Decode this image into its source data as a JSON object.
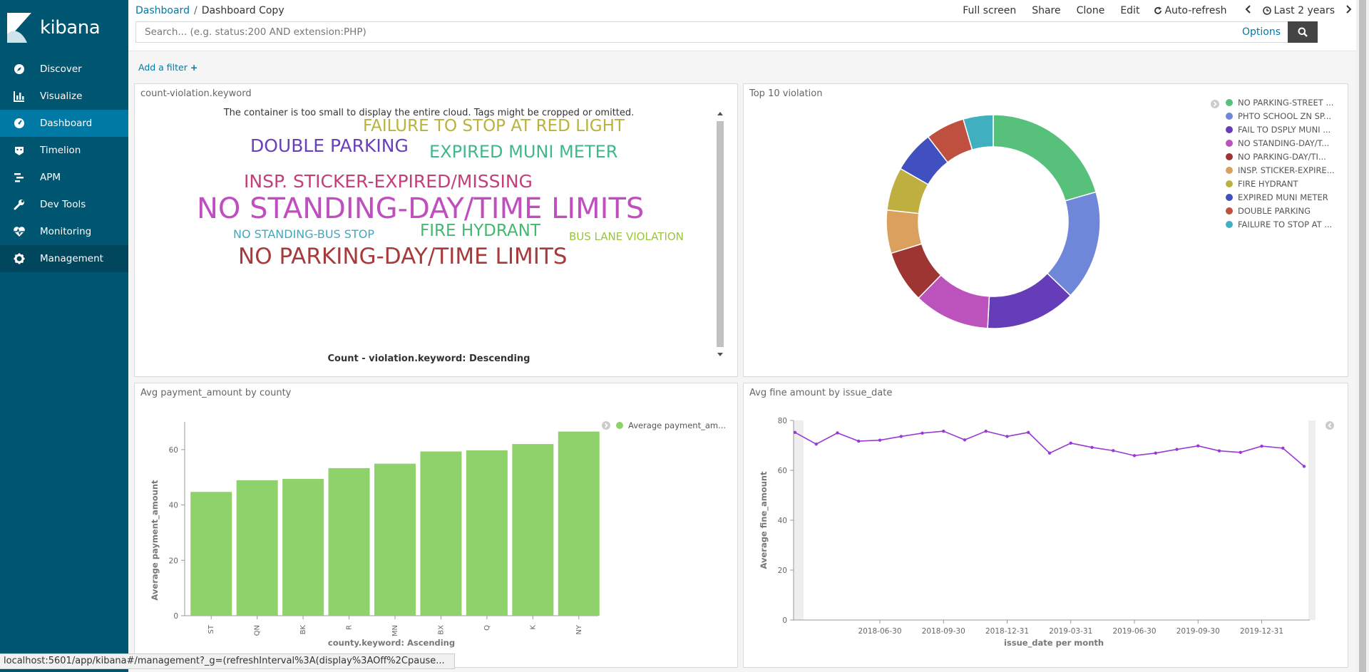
{
  "app": {
    "brand": "kibana"
  },
  "sidebar": {
    "items": [
      {
        "label": "Discover",
        "icon": "compass-icon"
      },
      {
        "label": "Visualize",
        "icon": "bar-chart-icon"
      },
      {
        "label": "Dashboard",
        "icon": "dashboard-icon",
        "active": true
      },
      {
        "label": "Timelion",
        "icon": "timelion-icon"
      },
      {
        "label": "APM",
        "icon": "apm-icon"
      },
      {
        "label": "Dev Tools",
        "icon": "wrench-icon"
      },
      {
        "label": "Monitoring",
        "icon": "heartbeat-icon"
      },
      {
        "label": "Management",
        "icon": "gear-icon"
      }
    ]
  },
  "breadcrumb": {
    "parent": "Dashboard",
    "separator": "/",
    "current": "Dashboard Copy"
  },
  "top_actions": {
    "full_screen": "Full screen",
    "share": "Share",
    "clone": "Clone",
    "edit": "Edit",
    "auto_refresh": "Auto-refresh",
    "time_range": "Last 2 years"
  },
  "search": {
    "placeholder": "Search... (e.g. status:200 AND extension:PHP)",
    "value": "",
    "options_label": "Options"
  },
  "filters": {
    "add_label": "Add a filter"
  },
  "panels": {
    "cloud": {
      "title": "count-violation.keyword",
      "warning": "The container is too small to display the entire cloud. Tags might be cropped or omitted.",
      "footer": "Count - violation.keyword: Descending",
      "words": [
        {
          "text": "FAILURE TO STOP AT RED LIGHT",
          "color": "#b9b33c"
        },
        {
          "text": "DOUBLE PARKING",
          "color": "#6a3fb8"
        },
        {
          "text": "EXPIRED MUNI METER",
          "color": "#3fb88a"
        },
        {
          "text": "INSP. STICKER-EXPIRED/MISSING",
          "color": "#c43e7a"
        },
        {
          "text": "NO STANDING-DAY/TIME LIMITS",
          "color": "#c04ec0"
        },
        {
          "text": "NO STANDING-BUS STOP",
          "color": "#44a7c0"
        },
        {
          "text": "FIRE HYDRANT",
          "color": "#44b870"
        },
        {
          "text": "BUS LANE VIOLATION",
          "color": "#9ac43e"
        },
        {
          "text": "NO PARKING-DAY/TIME LIMITS",
          "color": "#a73a3a"
        }
      ]
    },
    "pie": {
      "title": "Top 10 violation",
      "legend": [
        {
          "label": "NO PARKING-STREET ...",
          "color": "#57c17b"
        },
        {
          "label": "PHTO SCHOOL ZN SP...",
          "color": "#6f87d8"
        },
        {
          "label": "FAIL TO DSPLY MUNI ...",
          "color": "#663db8"
        },
        {
          "label": "NO STANDING-DAY/T...",
          "color": "#bc52bc"
        },
        {
          "label": "NO PARKING-DAY/TI...",
          "color": "#9e3533"
        },
        {
          "label": "INSP. STICKER-EXPIRE...",
          "color": "#daa05d"
        },
        {
          "label": "FIRE HYDRANT",
          "color": "#bfaf40"
        },
        {
          "label": "EXPIRED MUNI METER",
          "color": "#4050bf"
        },
        {
          "label": "DOUBLE PARKING",
          "color": "#bf5040"
        },
        {
          "label": "FAILURE TO STOP AT ...",
          "color": "#40afbf"
        }
      ]
    },
    "bar": {
      "title": "Avg payment_amount by county",
      "legend_label": "Average payment_am...",
      "bar_color": "#8fd16a"
    },
    "line": {
      "title": "Avg fine amount by issue_date",
      "line_color": "#9b3ad0"
    }
  },
  "chart_data": [
    {
      "type": "pie",
      "title": "Top 10 violation",
      "labels": [
        "NO PARKING-STREET ...",
        "PHTO SCHOOL ZN SP...",
        "FAIL TO DSPLY MUNI ...",
        "NO STANDING-DAY/T...",
        "NO PARKING-DAY/TI...",
        "INSP. STICKER-EXPIRE...",
        "FIRE HYDRANT",
        "EXPIRED MUNI METER",
        "DOUBLE PARKING",
        "FAILURE TO STOP AT ..."
      ],
      "values": [
        19.5,
        15.8,
        13.0,
        10.9,
        7.5,
        6.2,
        6.2,
        6.0,
        5.6,
        4.3
      ],
      "donut": true
    },
    {
      "type": "bar",
      "title": "Avg payment_amount by county",
      "categories": [
        "ST",
        "QN",
        "BK",
        "R",
        "MN",
        "BX",
        "Q",
        "K",
        "NY"
      ],
      "series": [
        {
          "name": "Average payment_am...",
          "values": [
            44.7,
            48.9,
            49.4,
            53.3,
            54.9,
            59.3,
            59.7,
            62.0,
            66.5
          ]
        }
      ],
      "xlabel": "county.keyword: Ascending",
      "ylabel": "Average payment_amount",
      "ylim": [
        0,
        70
      ],
      "yticks": [
        0,
        20,
        40,
        60
      ]
    },
    {
      "type": "line",
      "title": "Avg fine amount by issue_date",
      "x": [
        "2018-02-28",
        "2018-03-31",
        "2018-04-30",
        "2018-05-31",
        "2018-06-30",
        "2018-07-31",
        "2018-08-31",
        "2018-09-30",
        "2018-10-31",
        "2018-11-30",
        "2018-12-31",
        "2019-01-31",
        "2019-02-28",
        "2019-03-31",
        "2019-04-30",
        "2019-05-31",
        "2019-06-30",
        "2019-07-31",
        "2019-08-31",
        "2019-09-30",
        "2019-10-31",
        "2019-11-30",
        "2019-12-31",
        "2020-01-31",
        "2020-02-29"
      ],
      "series": [
        {
          "name": "Average fine_amount",
          "values": [
            75.2,
            70.5,
            75.0,
            71.7,
            72.1,
            73.6,
            74.9,
            75.7,
            72.2,
            75.7,
            73.6,
            75.2,
            66.9,
            70.9,
            69.2,
            67.9,
            65.9,
            66.9,
            68.4,
            69.8,
            67.8,
            67.2,
            69.7,
            68.9,
            61.6
          ]
        }
      ],
      "xlabel": "issue_date per month",
      "ylabel": "Average fine_amount",
      "ylim": [
        0,
        80
      ],
      "yticks": [
        0,
        20,
        40,
        60,
        80
      ],
      "xtick_labels": [
        "2018-06-30",
        "2018-09-30",
        "2018-12-31",
        "2019-03-31",
        "2019-06-30",
        "2019-09-30",
        "2019-12-31"
      ]
    }
  ],
  "statusbar": {
    "url": "localhost:5601/app/kibana#/management?_g=(refreshInterval%3A(display%3AOff%2Cpause..."
  }
}
